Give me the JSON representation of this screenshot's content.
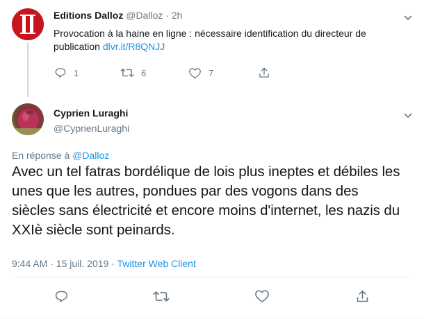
{
  "parent_tweet": {
    "display_name": "Editions Dalloz",
    "handle": "@Dalloz",
    "separator": "·",
    "time": "2h",
    "text": "Provocation à la haine en ligne : nécessaire identification du directeur de publication ",
    "link": "dlvr.it/R8QNJJ",
    "actions": {
      "reply_count": "1",
      "retweet_count": "6",
      "like_count": "7"
    }
  },
  "main_tweet": {
    "display_name": "Cyprien Luraghi",
    "handle": "@CyprienLuraghi",
    "reply_prefix": "En réponse à ",
    "reply_to": "@Dalloz",
    "text": "Avec un tel fatras bordélique de lois plus ineptes et débiles les unes que les autres, pondues par des vogons dans des siècles sans électricité et encore moins d'internet, les nazis du XXIè siècle sont peinards.",
    "timestamp": "9:44 AM · 15 juil. 2019 · ",
    "source": "Twitter Web Client"
  },
  "colors": {
    "accent": "#1b95e0",
    "secondary_text": "#657786",
    "primary_text": "#14171a",
    "dalloz_red": "#c8141e"
  },
  "icons": [
    "reply-icon",
    "retweet-icon",
    "like-icon",
    "share-icon",
    "chevron-down-icon"
  ]
}
